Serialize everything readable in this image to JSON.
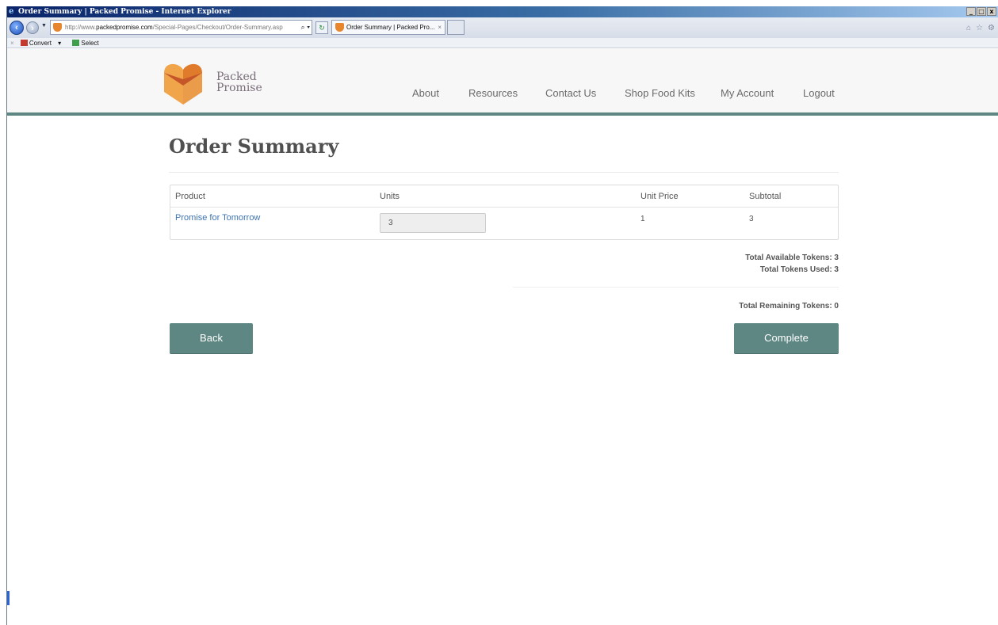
{
  "window": {
    "title": "Order Summary | Packed Promise - Internet Explorer",
    "controls": [
      "_",
      "□",
      "x"
    ]
  },
  "browser": {
    "address_prefix": "http://www.",
    "address_domain": "packedpromise.com",
    "address_path": "/Special-Pages/Checkout/Order-Summary.asp",
    "address_search_glyph": "⌕ ▾",
    "refresh_glyph": "↻",
    "tab_label": "Order Summary | Packed Pro...",
    "tab_close": "×",
    "right_icons": [
      "⌂",
      "☆",
      "⚙"
    ]
  },
  "command_bar": {
    "close": "×",
    "convert": "Convert",
    "dropdown": "▾",
    "select": "Select"
  },
  "site": {
    "brand_line1": "Packed",
    "brand_line2": "Promise",
    "nav": [
      "About",
      "Resources",
      "Contact Us",
      "Shop Food Kits",
      "My Account",
      "Logout"
    ],
    "accent_color": "#5e8784",
    "logo_colors": [
      "#f0a54a",
      "#e07b2c",
      "#c4562a"
    ]
  },
  "page": {
    "title": "Order Summary"
  },
  "cart": {
    "headers": {
      "product": "Product",
      "units": "Units",
      "unit_price": "Unit Price",
      "subtotal": "Subtotal"
    },
    "rows": [
      {
        "product": "Promise for Tomorrow",
        "units": "3",
        "unit_price": "1",
        "subtotal": "3"
      }
    ]
  },
  "totals": {
    "available": "Total Available Tokens: 3",
    "used": "Total Tokens Used: 3",
    "remaining": "Total Remaining Tokens: 0"
  },
  "buttons": {
    "back": "Back",
    "complete": "Complete"
  }
}
